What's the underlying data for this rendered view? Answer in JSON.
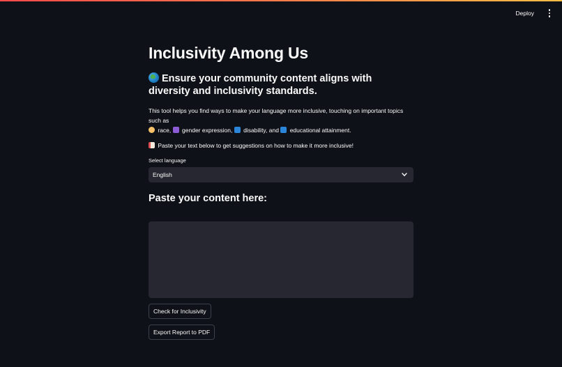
{
  "header": {
    "deploy_label": "Deploy"
  },
  "main": {
    "title": "Inclusivity Among Us",
    "subheader": "Ensure your community content aligns with diversity and inclusivity standards.",
    "description_line1": "This tool helps you find ways to make your language more inclusive, touching on important topics such as",
    "topics": [
      "race,",
      "gender expression,",
      "disability, and",
      "educational attainment."
    ],
    "instruction": "Paste your text below to get suggestions on how to make it more inclusive!",
    "select_label": "Select language",
    "select_value": "English",
    "section_title": "Paste your content here:",
    "textarea_value": "",
    "check_button": "Check for Inclusivity",
    "export_button": "Export Report to PDF"
  },
  "icons": [
    "globe-icon",
    "handshake-icon",
    "gender-icon",
    "accessibility-icon",
    "education-icon",
    "page-icon",
    "chevron-down-icon",
    "more-vertical-icon"
  ],
  "colors": {
    "background": "#0e1117",
    "input_background": "#262730",
    "accent_gradient_start": "#ff4b4b",
    "accent_gradient_end": "#ffbd45"
  }
}
